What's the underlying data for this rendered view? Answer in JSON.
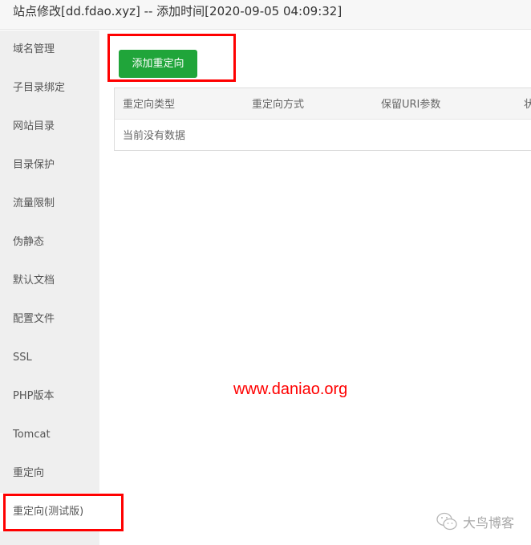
{
  "window": {
    "title": "站点修改[dd.fdao.xyz] -- 添加时间[2020-09-05 04:09:32]"
  },
  "sidebar": {
    "items": [
      {
        "label": "域名管理"
      },
      {
        "label": "子目录绑定"
      },
      {
        "label": "网站目录"
      },
      {
        "label": "目录保护"
      },
      {
        "label": "流量限制"
      },
      {
        "label": "伪静态"
      },
      {
        "label": "默认文档"
      },
      {
        "label": "配置文件"
      },
      {
        "label": "SSL"
      },
      {
        "label": "PHP版本"
      },
      {
        "label": "Tomcat"
      },
      {
        "label": "重定向"
      },
      {
        "label": "重定向(测试版)",
        "active": true
      }
    ]
  },
  "main": {
    "add_button_label": "添加重定向",
    "table": {
      "columns": [
        "重定向类型",
        "重定向方式",
        "保留URI参数",
        "状"
      ],
      "empty_text": "当前没有数据"
    }
  },
  "overlay": {
    "watermark_text": "www.daniao.org",
    "wechat_label": "大鸟博客",
    "highlight_color": "#ff0000"
  },
  "colors": {
    "accent_green": "#20a53a",
    "sidebar_bg": "#efefef",
    "highlight_red": "#ff0000"
  }
}
